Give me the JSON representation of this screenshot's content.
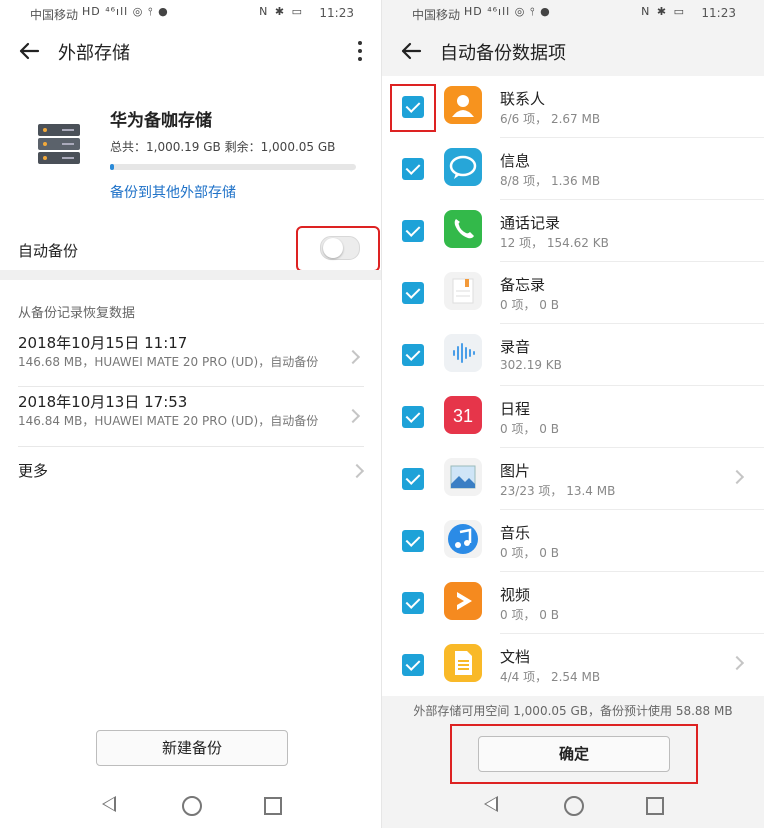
{
  "left": {
    "status": {
      "carrier": "中国移动",
      "icons_left": "HD ⁴⁶ıll ◎ ⫯ ●",
      "icons_right": "N ✱ ▭",
      "time": "11:23"
    },
    "appbar": {
      "title": "外部存储"
    },
    "storage": {
      "name": "华为备咖存储",
      "usage": "总共：1,000.19 GB  剩余：1,000.05 GB",
      "used_fraction": 0.01,
      "backup_other": "备份到其他外部存储"
    },
    "auto_backup": {
      "label": "自动备份",
      "enabled": false
    },
    "restore": {
      "title": "从备份记录恢复数据",
      "records": [
        {
          "date": "2018年10月15日 11:17",
          "detail": "146.68 MB，HUAWEI MATE 20 PRO (UD)，自动备份"
        },
        {
          "date": "2018年10月13日 17:53",
          "detail": "146.84 MB，HUAWEI MATE 20 PRO (UD)，自动备份"
        }
      ],
      "more": "更多"
    },
    "new_backup": "新建备份"
  },
  "right": {
    "status": {
      "carrier": "中国移动",
      "icons_left": "HD ⁴⁶ıll ◎ ⫯ ●",
      "icons_right": "N ✱ ▭",
      "time": "11:23"
    },
    "appbar": {
      "title": "自动备份数据项"
    },
    "items": [
      {
        "name": "联系人",
        "meta": "6/6 项， 2.67 MB",
        "icon": "contacts-icon",
        "checked": true
      },
      {
        "name": "信息",
        "meta": "8/8 项， 1.36 MB",
        "icon": "messages-icon",
        "checked": true
      },
      {
        "name": "通话记录",
        "meta": "12 项， 154.62 KB",
        "icon": "call-log-icon",
        "checked": true
      },
      {
        "name": "备忘录",
        "meta": "0 项， 0 B",
        "icon": "notepad-icon",
        "checked": true
      },
      {
        "name": "录音",
        "meta": "302.19 KB",
        "icon": "recorder-icon",
        "checked": true
      },
      {
        "name": "日程",
        "meta": "0 项， 0 B",
        "icon": "calendar-icon",
        "icon_text": "31",
        "checked": true
      },
      {
        "name": "图片",
        "meta": "23/23 项， 13.4 MB",
        "icon": "gallery-icon",
        "checked": true
      },
      {
        "name": "音乐",
        "meta": "0 项， 0 B",
        "icon": "music-icon",
        "checked": true
      },
      {
        "name": "视频",
        "meta": "0 项， 0 B",
        "icon": "video-icon",
        "checked": true
      },
      {
        "name": "文档",
        "meta": "4/4 项， 2.54 MB",
        "icon": "document-icon",
        "checked": true
      }
    ],
    "footer_note": "外部存储可用空间 1,000.05 GB，备份预计使用 58.88 MB",
    "confirm": "确定"
  },
  "colors": {
    "accent": "#1ea2d8",
    "link": "#1f72c8",
    "highlight": "#dd2222"
  }
}
